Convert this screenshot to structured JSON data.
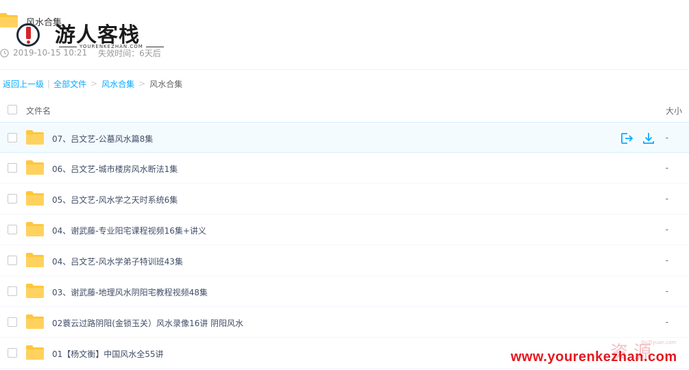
{
  "header": {
    "title": "风水合集",
    "created": "2019-10-15 10:21",
    "expire_label": "失效时间：6天后"
  },
  "watermark": {
    "logo_title": "游人客栈",
    "logo_sub": "YOURENKEZHAN.COM",
    "bottom_url": "www.yourenkezhan.com",
    "ziyuan": "资 源",
    "quzi": "QuZiyuan.com"
  },
  "breadcrumb": {
    "back": "返回上一级",
    "all_files": "全部文件",
    "level1": "风水合集",
    "current": "风水合集"
  },
  "list_header": {
    "name": "文件名",
    "size": "大小"
  },
  "files": [
    {
      "name": "07、吕文艺-公墓风水篇8集",
      "size": "-"
    },
    {
      "name": "06、吕文艺-城市楼房风水断法1集",
      "size": "-"
    },
    {
      "name": "05、吕文艺-风水学之天时系统6集",
      "size": "-"
    },
    {
      "name": "04、谢武藤-专业阳宅课程视频16集+讲义",
      "size": "-"
    },
    {
      "name": "04、吕文艺-风水学弟子特训班43集",
      "size": "-"
    },
    {
      "name": "03、谢武藤-地理风水阴阳宅教程视频48集",
      "size": "-"
    },
    {
      "name": "02蓑云过路阴阳(金锁玉关）风水录像16讲 阴阳风水",
      "size": "-"
    },
    {
      "name": "01【杨文衡】中国风水全55讲",
      "size": ""
    }
  ],
  "icons": {
    "folder": "folder-icon",
    "clock": "clock-icon",
    "share": "save-to-drive-icon",
    "download": "download-icon"
  },
  "colors": {
    "link": "#09aaff",
    "folder": "#ffd25f",
    "hover_row": "#f4fbff"
  }
}
